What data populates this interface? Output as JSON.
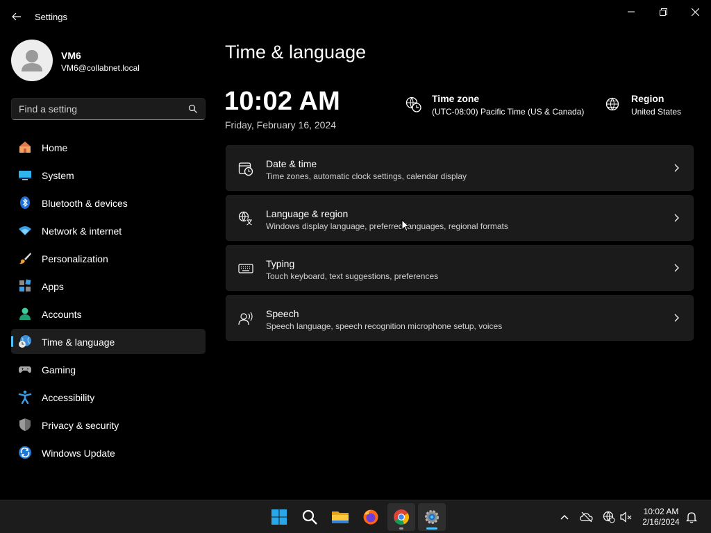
{
  "window": {
    "title": "Settings"
  },
  "user": {
    "name": "VM6",
    "email": "VM6@collabnet.local"
  },
  "search": {
    "placeholder": "Find a setting"
  },
  "nav": {
    "items": [
      {
        "label": "Home",
        "icon": "home-icon"
      },
      {
        "label": "System",
        "icon": "system-icon"
      },
      {
        "label": "Bluetooth & devices",
        "icon": "bluetooth-icon"
      },
      {
        "label": "Network & internet",
        "icon": "wifi-icon"
      },
      {
        "label": "Personalization",
        "icon": "brush-icon"
      },
      {
        "label": "Apps",
        "icon": "apps-icon"
      },
      {
        "label": "Accounts",
        "icon": "accounts-icon"
      },
      {
        "label": "Time & language",
        "icon": "time-language-icon",
        "selected": true
      },
      {
        "label": "Gaming",
        "icon": "gamepad-icon"
      },
      {
        "label": "Accessibility",
        "icon": "accessibility-icon"
      },
      {
        "label": "Privacy & security",
        "icon": "shield-icon"
      },
      {
        "label": "Windows Update",
        "icon": "update-icon"
      }
    ]
  },
  "main": {
    "title": "Time & language",
    "clock": "10:02 AM",
    "date": "Friday, February 16, 2024",
    "timezone": {
      "title": "Time zone",
      "value": "(UTC-08:00) Pacific Time (US & Canada)"
    },
    "region": {
      "title": "Region",
      "value": "United States"
    },
    "cards": [
      {
        "title": "Date & time",
        "subtitle": "Time zones, automatic clock settings, calendar display",
        "icon": "calendar-clock-icon"
      },
      {
        "title": "Language & region",
        "subtitle": "Windows display language, preferred languages, regional formats",
        "icon": "language-icon"
      },
      {
        "title": "Typing",
        "subtitle": "Touch keyboard, text suggestions, preferences",
        "icon": "keyboard-icon"
      },
      {
        "title": "Speech",
        "subtitle": "Speech language, speech recognition microphone setup, voices",
        "icon": "speech-icon"
      }
    ]
  },
  "taskbar": {
    "time": "10:02 AM",
    "date": "2/16/2024"
  },
  "colors": {
    "accent": "#4cc2ff",
    "card": "#1b1b1b",
    "background": "#000000"
  }
}
